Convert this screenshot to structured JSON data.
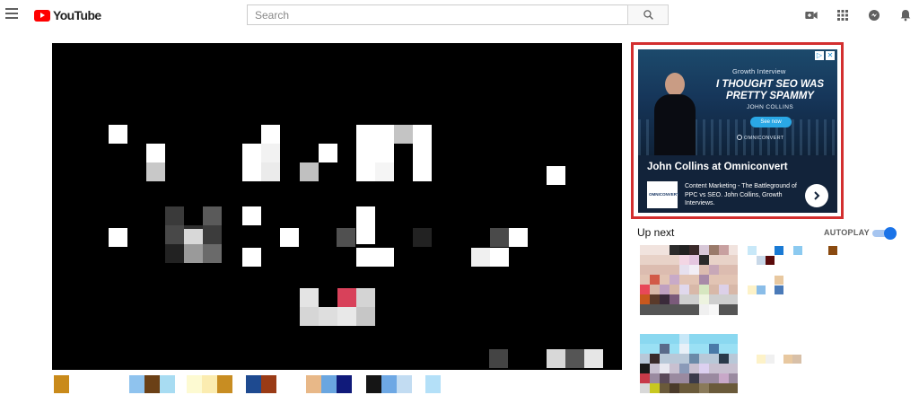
{
  "header": {
    "logo_text": "YouTube",
    "search_placeholder": "Search",
    "icons": [
      "menu-icon",
      "search-icon",
      "video-camera-icon",
      "apps-grid-icon",
      "messages-icon",
      "bell-icon"
    ]
  },
  "ad": {
    "brand": "Growth Interview",
    "headline": "I THOUGHT SEO WAS PRETTY SPAMMY",
    "person": "JOHN COLLINS",
    "cta": "See now",
    "sponsor": "OMNICONVERT",
    "title": "John Collins at Omniconvert",
    "logo_text": "OMNICONVERT",
    "description": "Content Marketing - The Battleground of PPC vs SEO. John Collins, Growth Interviews.",
    "highlight_color": "#d32f2f"
  },
  "sidebar": {
    "upnext_label": "Up next",
    "autoplay_label": "AUTOPLAY",
    "autoplay_on": true
  },
  "colors": {
    "accent": "#1a73e8",
    "brand_red": "#ff0000"
  }
}
